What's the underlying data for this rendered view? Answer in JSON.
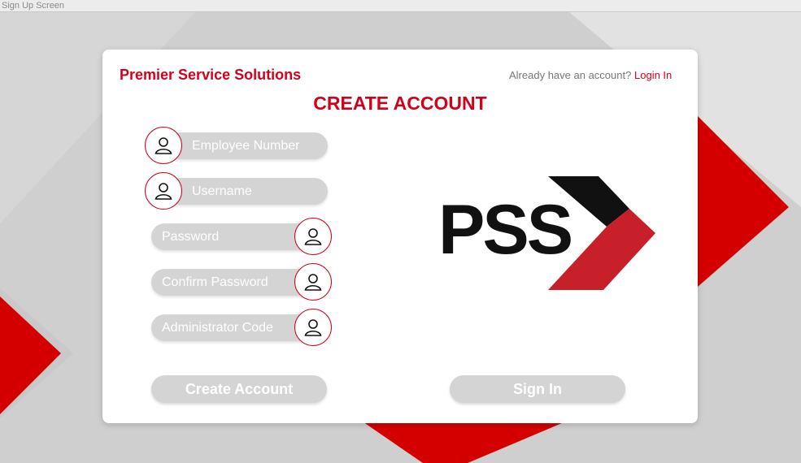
{
  "window": {
    "title": "Sign Up Screen"
  },
  "header": {
    "brand": "Premier Service Solutions",
    "already_text": "Already have an account?",
    "login_link": "Login In",
    "heading": "CREATE ACCOUNT"
  },
  "form": {
    "employee_number_placeholder": "Employee Number",
    "username_placeholder": "Username",
    "password_placeholder": "Password",
    "confirm_password_placeholder": "Confirm Password",
    "admin_code_placeholder": "Administrator Code"
  },
  "buttons": {
    "create_account": "Create Account",
    "sign_in": "Sign In"
  },
  "logo": {
    "text": "PSS"
  },
  "colors": {
    "accent": "#d0021b",
    "field_bg": "#d4d4d4",
    "logo_dark": "#111111",
    "logo_red": "#c8202a"
  },
  "icons": {
    "field_icon": "user-icon"
  }
}
